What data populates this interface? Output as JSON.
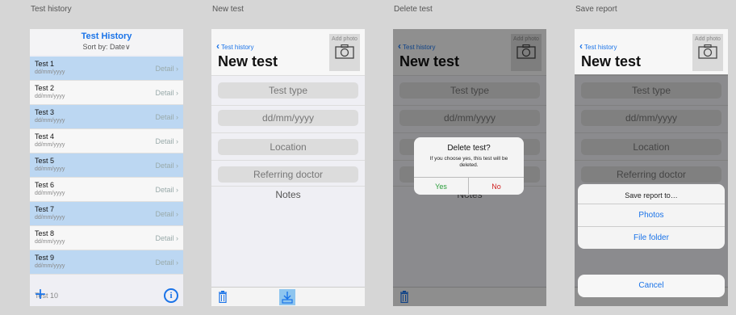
{
  "captions": [
    "Test history",
    "New test",
    "Delete test",
    "Save report"
  ],
  "history": {
    "title": "Test History",
    "sort": "Sort by: Date∨",
    "detail_label": "Detail ›",
    "rows": [
      {
        "name": "Test 1",
        "date": "dd/mm/yyyy"
      },
      {
        "name": "Test 2",
        "date": "dd/mm/yyyy"
      },
      {
        "name": "Test 3",
        "date": "dd/mm/yyyy"
      },
      {
        "name": "Test 4",
        "date": "dd/mm/yyyy"
      },
      {
        "name": "Test 5",
        "date": "dd/mm/yyyy"
      },
      {
        "name": "Test 6",
        "date": "dd/mm/yyyy"
      },
      {
        "name": "Test 7",
        "date": "dd/mm/yyyy"
      },
      {
        "name": "Test 8",
        "date": "dd/mm/yyyy"
      },
      {
        "name": "Test 9",
        "date": "dd/mm/yyyy"
      }
    ],
    "ghost_row": "Test 10",
    "plus": "+",
    "info": "i"
  },
  "new_test": {
    "back": "Test history",
    "back_chevron": "‹",
    "title": "New test",
    "add_photo": "Add photo",
    "fields": {
      "type": "Test type",
      "date": "dd/mm/yyyy",
      "location": "Location",
      "doctor": "Referring doctor"
    },
    "notes": "Notes"
  },
  "delete_alert": {
    "title": "Delete test?",
    "message": "If you choose yes, this test will be deleted.",
    "yes": "Yes",
    "no": "No"
  },
  "save_sheet": {
    "title": "Save report to…",
    "options": [
      "Photos",
      "File folder"
    ],
    "cancel": "Cancel"
  },
  "colors": {
    "accent": "#1a73e8",
    "row_blue": "#bcd7f2",
    "yes": "#2a9d3a",
    "no": "#d02020"
  }
}
